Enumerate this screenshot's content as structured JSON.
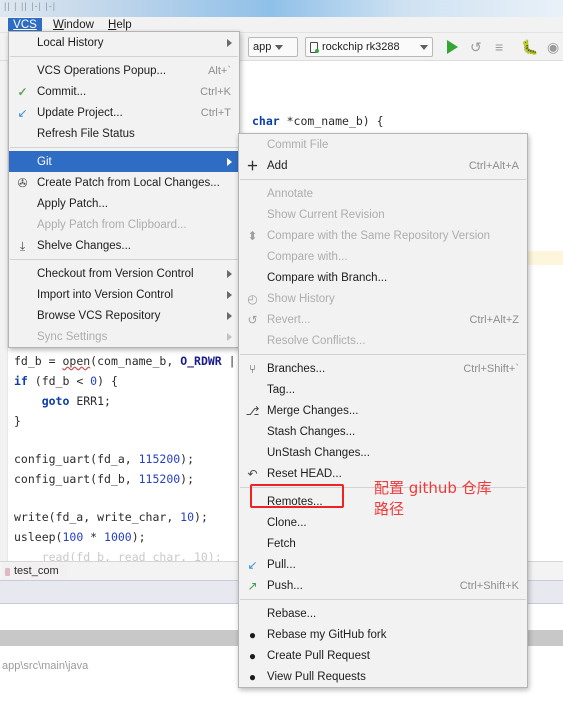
{
  "window": {
    "ghost_strip_text": "|| |    || |-| |-|"
  },
  "menubar": {
    "items": [
      {
        "label": "VCS",
        "mnemonic": "VCS",
        "active": true
      },
      {
        "label": "Window",
        "mnemonic": "W",
        "active": false
      },
      {
        "label": "Help",
        "mnemonic": "H",
        "active": false
      }
    ]
  },
  "toolbar": {
    "run_config": "app",
    "device": "rockchip rk3288",
    "icons": [
      "run-icon",
      "rerun-icon",
      "logcat-icon",
      "debug-icon",
      "attach-icon"
    ]
  },
  "editor": {
    "signature_line": "char *com_name_b) {",
    "lines": [
      "fd_b = open(com_name_b, O_RDWR |",
      "if (fd_b < 0) {",
      "    goto ERR1;",
      "}",
      "",
      "config_uart(fd_a, 115200);",
      "config_uart(fd_b, 115200);",
      "",
      "write(fd_a, write_char, 10);",
      "usleep(100 * 1000);"
    ],
    "tab_label": "test_com",
    "status_path": "app\\src\\main\\java"
  },
  "vcs_menu": {
    "items": [
      {
        "label": "Local History",
        "icon": "",
        "accel": "",
        "submenu": true,
        "disabled": false,
        "selected": false,
        "mnemonic": "H"
      },
      {
        "separator": true
      },
      {
        "label": "VCS Operations Popup...",
        "icon": "",
        "accel": "Alt+`",
        "submenu": false,
        "disabled": false,
        "selected": false,
        "mnemonic": ""
      },
      {
        "label": "Commit...",
        "icon": "check-icon",
        "accel": "Ctrl+K",
        "submenu": false,
        "disabled": false,
        "selected": false,
        "mnemonic": "t"
      },
      {
        "label": "Update Project...",
        "icon": "arrow-down-left-icon",
        "accel": "Ctrl+T",
        "submenu": false,
        "disabled": false,
        "selected": false,
        "mnemonic": "U"
      },
      {
        "label": "Refresh File Status",
        "icon": "",
        "accel": "",
        "submenu": false,
        "disabled": false,
        "selected": false,
        "mnemonic": "e"
      },
      {
        "separator": true
      },
      {
        "label": "Git",
        "icon": "",
        "accel": "",
        "submenu": true,
        "disabled": false,
        "selected": true,
        "mnemonic": "G"
      },
      {
        "label": "Create Patch from Local Changes...",
        "icon": "patch-icon",
        "accel": "",
        "submenu": false,
        "disabled": false,
        "selected": false,
        "mnemonic": ""
      },
      {
        "label": "Apply Patch...",
        "icon": "",
        "accel": "",
        "submenu": false,
        "disabled": false,
        "selected": false,
        "mnemonic": ""
      },
      {
        "label": "Apply Patch from Clipboard...",
        "icon": "",
        "accel": "",
        "submenu": false,
        "disabled": true,
        "selected": false,
        "mnemonic": ""
      },
      {
        "label": "Shelve Changes...",
        "icon": "shelve-icon",
        "accel": "",
        "submenu": false,
        "disabled": false,
        "selected": false,
        "mnemonic": ""
      },
      {
        "separator": true
      },
      {
        "label": "Checkout from Version Control",
        "icon": "",
        "accel": "",
        "submenu": true,
        "disabled": false,
        "selected": false,
        "mnemonic": "o"
      },
      {
        "label": "Import into Version Control",
        "icon": "",
        "accel": "",
        "submenu": true,
        "disabled": false,
        "selected": false,
        "mnemonic": ""
      },
      {
        "label": "Browse VCS Repository",
        "icon": "",
        "accel": "",
        "submenu": true,
        "disabled": false,
        "selected": false,
        "mnemonic": ""
      },
      {
        "label": "Sync Settings",
        "icon": "",
        "accel": "",
        "submenu": true,
        "disabled": true,
        "selected": false,
        "mnemonic": ""
      }
    ]
  },
  "git_submenu": {
    "items": [
      {
        "label": "Commit File",
        "icon": "",
        "accel": "",
        "disabled": true,
        "highlighted": false,
        "mnemonic": "i"
      },
      {
        "label": "Add",
        "icon": "plus-icon",
        "accel": "Ctrl+Alt+A",
        "disabled": false,
        "highlighted": false,
        "mnemonic": ""
      },
      {
        "separator": true
      },
      {
        "label": "Annotate",
        "icon": "",
        "accel": "",
        "disabled": true,
        "highlighted": false,
        "mnemonic": "n"
      },
      {
        "label": "Show Current Revision",
        "icon": "",
        "accel": "",
        "disabled": true,
        "highlighted": false,
        "mnemonic": ""
      },
      {
        "label": "Compare with the Same Repository Version",
        "icon": "compare-icon",
        "accel": "",
        "disabled": true,
        "highlighted": false,
        "mnemonic": ""
      },
      {
        "label": "Compare with...",
        "icon": "",
        "accel": "",
        "disabled": true,
        "highlighted": false,
        "mnemonic": "C"
      },
      {
        "label": "Compare with Branch...",
        "icon": "",
        "accel": "",
        "disabled": false,
        "highlighted": false,
        "mnemonic": ""
      },
      {
        "label": "Show History",
        "icon": "clock-icon",
        "accel": "",
        "disabled": true,
        "highlighted": false,
        "mnemonic": "H"
      },
      {
        "label": "Revert...",
        "icon": "revert-icon",
        "accel": "Ctrl+Alt+Z",
        "disabled": true,
        "highlighted": false,
        "mnemonic": "R"
      },
      {
        "label": "Resolve Conflicts...",
        "icon": "",
        "accel": "",
        "disabled": true,
        "highlighted": false,
        "mnemonic": ""
      },
      {
        "separator": true
      },
      {
        "label": "Branches...",
        "icon": "branch-icon",
        "accel": "Ctrl+Shift+`",
        "disabled": false,
        "highlighted": false,
        "mnemonic": "B"
      },
      {
        "label": "Tag...",
        "icon": "",
        "accel": "",
        "disabled": false,
        "highlighted": false,
        "mnemonic": ""
      },
      {
        "label": "Merge Changes...",
        "icon": "merge-icon",
        "accel": "",
        "disabled": false,
        "highlighted": false,
        "mnemonic": ""
      },
      {
        "label": "Stash Changes...",
        "icon": "",
        "accel": "",
        "disabled": false,
        "highlighted": false,
        "mnemonic": ""
      },
      {
        "label": "UnStash Changes...",
        "icon": "",
        "accel": "",
        "disabled": false,
        "highlighted": false,
        "mnemonic": ""
      },
      {
        "label": "Reset HEAD...",
        "icon": "reset-icon",
        "accel": "",
        "disabled": false,
        "highlighted": false,
        "mnemonic": ""
      },
      {
        "separator": true
      },
      {
        "label": "Remotes...",
        "icon": "",
        "accel": "",
        "disabled": false,
        "highlighted": true,
        "mnemonic": ""
      },
      {
        "label": "Clone...",
        "icon": "",
        "accel": "",
        "disabled": false,
        "highlighted": false,
        "mnemonic": ""
      },
      {
        "label": "Fetch",
        "icon": "",
        "accel": "",
        "disabled": false,
        "highlighted": false,
        "mnemonic": ""
      },
      {
        "label": "Pull...",
        "icon": "pull-icon",
        "accel": "",
        "disabled": false,
        "highlighted": false,
        "mnemonic": ""
      },
      {
        "label": "Push...",
        "icon": "push-icon",
        "accel": "Ctrl+Shift+K",
        "disabled": false,
        "highlighted": false,
        "mnemonic": ""
      },
      {
        "separator": true
      },
      {
        "label": "Rebase...",
        "icon": "",
        "accel": "",
        "disabled": false,
        "highlighted": false,
        "mnemonic": ""
      },
      {
        "label": "Rebase my GitHub fork",
        "icon": "github-icon",
        "accel": "",
        "disabled": false,
        "highlighted": false,
        "mnemonic": ""
      },
      {
        "label": "Create Pull Request",
        "icon": "github-icon",
        "accel": "",
        "disabled": false,
        "highlighted": false,
        "mnemonic": ""
      },
      {
        "label": "View Pull Requests",
        "icon": "github-icon",
        "accel": "",
        "disabled": false,
        "highlighted": false,
        "mnemonic": ""
      }
    ]
  },
  "annotation": {
    "text": "配置 github 仓库\n路径",
    "color": "#ef3a3a",
    "target": "Remotes..."
  }
}
